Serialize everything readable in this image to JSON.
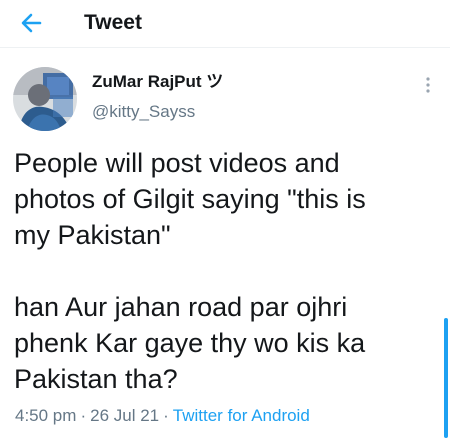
{
  "header": {
    "title": "Tweet",
    "back_icon": "arrow-left-icon",
    "accent": "#1da1f2"
  },
  "tweet": {
    "author": {
      "display_name": "ZuMar RajPut ツ",
      "handle": "@kitty_Sayss",
      "avatar_icon": "avatar"
    },
    "more_icon": "more-vertical-icon",
    "paragraphs": [
      "People will post videos and\nphotos of Gilgit saying \"this is\nmy Pakistan\"",
      "han Aur jahan road par ojhri\nphenk Kar gaye thy wo kis ka\nPakistan tha?"
    ],
    "time": "4:50 pm",
    "date": "26 Jul 21",
    "separator": "·",
    "source": "Twitter for Android"
  },
  "colors": {
    "text": "#14171a",
    "secondary": "#657786",
    "link": "#1da1f2"
  }
}
